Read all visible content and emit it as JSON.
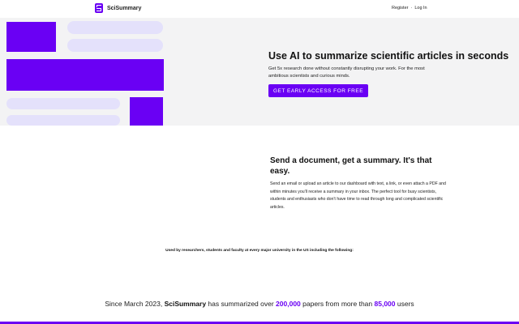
{
  "nav": {
    "brand": "SciSummary",
    "register": "Register",
    "separator": "·",
    "login": "Log In"
  },
  "hero": {
    "title": "Use AI to summarize scientific articles in seconds",
    "subtitle": "Get 5x research done without constantly disrupting your work. For the most ambitious scientists and curious minds.",
    "cta": "GET EARLY ACCESS FOR FREE"
  },
  "section": {
    "title": "Send a document, get a summary. It's that easy.",
    "body": "Send an email or upload an article to our dashboard with text, a link, or even attach a PDF and within minutes you'll receive a summary in your inbox. The perfect tool for busy scientists, students and enthusiasts who don't have time to read through long and complicated scientific articles."
  },
  "used_by": "Used by researchers, students and faculty at every major university in the US including the following:",
  "stats": {
    "prefix": "Since March 2023, ",
    "brand": "SciSummary",
    "middle": " has summarized over ",
    "papers": "200,000",
    "middle2": " papers from more than ",
    "users": "85,000",
    "suffix": " users"
  },
  "colors": {
    "accent": "#6a00f4",
    "placeholder": "#e4e1fb",
    "hero_bg": "#f3f3f4"
  },
  "icons": {
    "logo": "scisummary-logo-icon"
  }
}
